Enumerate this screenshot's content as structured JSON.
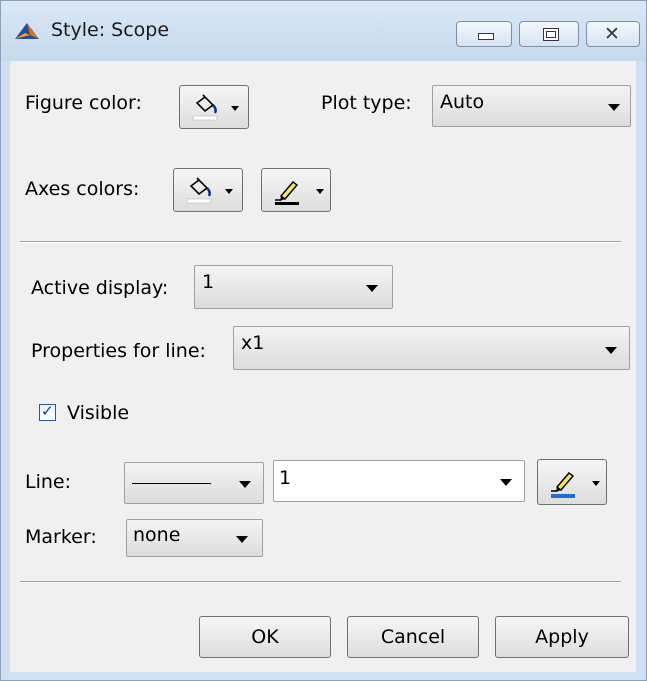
{
  "window": {
    "title": "Style: Scope"
  },
  "figure": {
    "label": "Figure color:"
  },
  "plot_type": {
    "label": "Plot type:",
    "value": "Auto"
  },
  "axes": {
    "label": "Axes colors:"
  },
  "active_display": {
    "label": "Active display:",
    "value": "1"
  },
  "properties": {
    "label": "Properties for line:",
    "value": "x1"
  },
  "visible": {
    "label": "Visible",
    "checked": true
  },
  "line": {
    "label": "Line:",
    "width": "1",
    "color": "#1f6fd1"
  },
  "marker": {
    "label": "Marker:",
    "value": "none"
  },
  "buttons": {
    "ok": "OK",
    "cancel": "Cancel",
    "apply": "Apply"
  }
}
